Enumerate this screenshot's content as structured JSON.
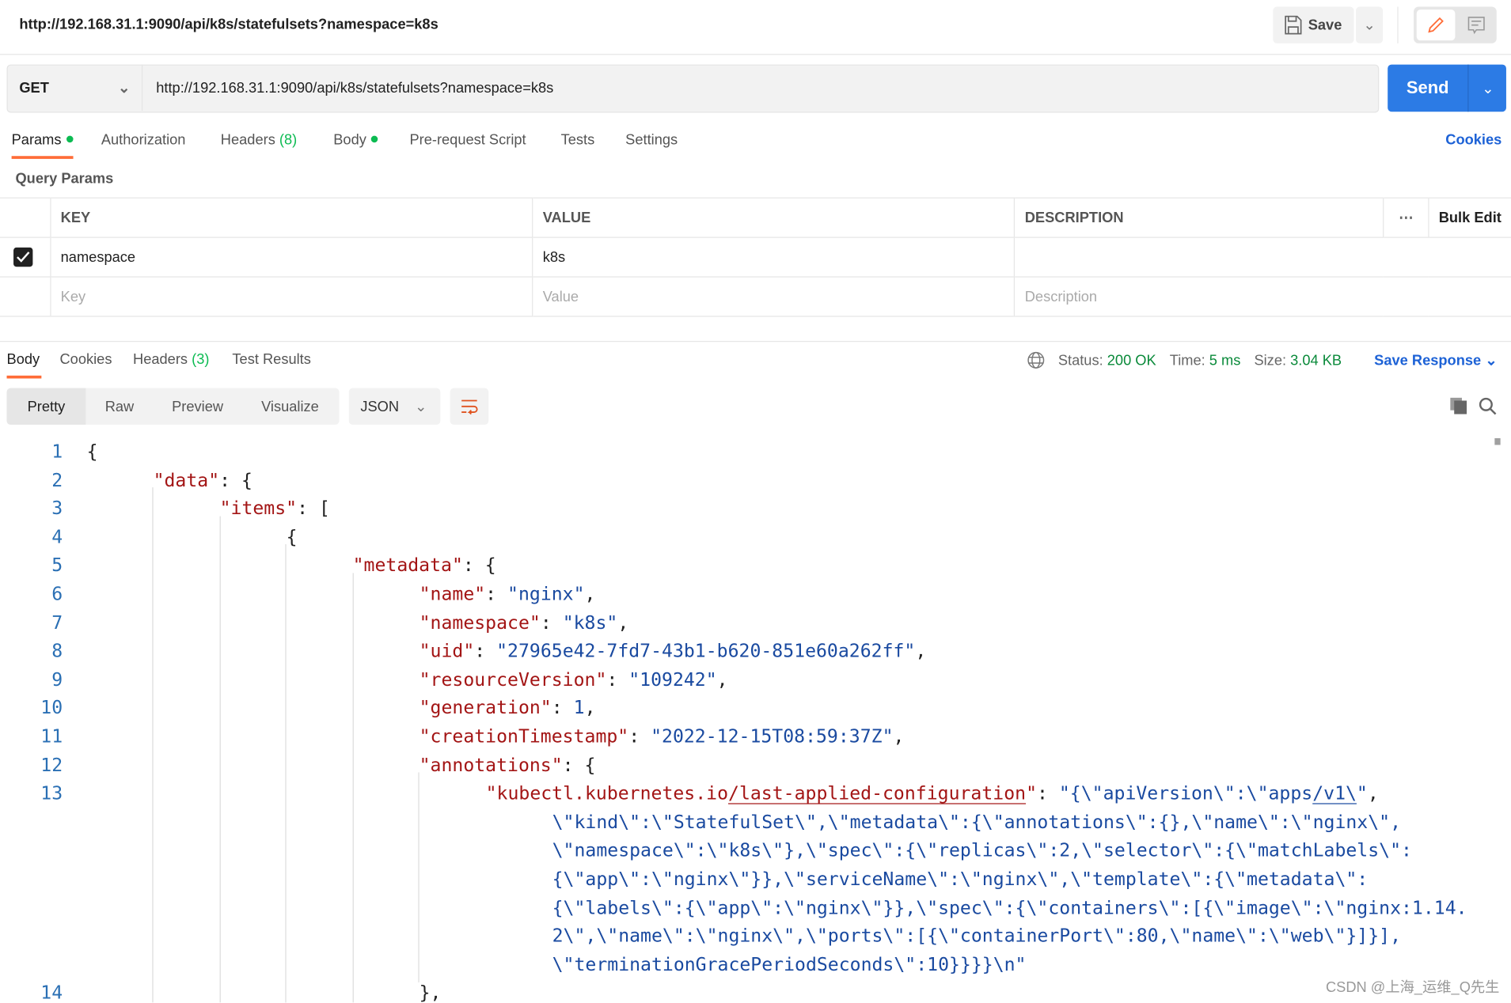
{
  "header": {
    "title": "http://192.168.31.1:9090/api/k8s/statefulsets?namespace=k8s",
    "save_label": "Save"
  },
  "request": {
    "method": "GET",
    "url": "http://192.168.31.1:9090/api/k8s/statefulsets?namespace=k8s",
    "send_label": "Send"
  },
  "tabs": {
    "params": "Params",
    "authorization": "Authorization",
    "headers": "Headers",
    "headers_count": "(8)",
    "body": "Body",
    "prerequest": "Pre-request Script",
    "tests": "Tests",
    "settings": "Settings",
    "cookies": "Cookies"
  },
  "query_params": {
    "title": "Query Params",
    "columns": [
      "KEY",
      "VALUE",
      "DESCRIPTION"
    ],
    "bulk_edit": "Bulk Edit",
    "rows": [
      {
        "checked": true,
        "key": "namespace",
        "value": "k8s",
        "description": ""
      }
    ],
    "placeholders": {
      "key": "Key",
      "value": "Value",
      "description": "Description"
    }
  },
  "response": {
    "tabs": {
      "body": "Body",
      "cookies": "Cookies",
      "headers": "Headers",
      "headers_count": "(3)",
      "test_results": "Test Results"
    },
    "status_label": "Status:",
    "status": "200 OK",
    "time_label": "Time:",
    "time": "5 ms",
    "size_label": "Size:",
    "size": "3.04 KB",
    "save_response": "Save Response",
    "views": [
      "Pretty",
      "Raw",
      "Preview",
      "Visualize"
    ],
    "format": "JSON"
  },
  "colors": {
    "accent": "#ff6c37",
    "send": "#2c7be5",
    "link": "#1d62d6",
    "ok": "#0a8a3a",
    "json_key": "#a31515",
    "json_string": "#1a4aa0"
  },
  "code_lines": [
    {
      "n": "1",
      "indent": 0,
      "t": [
        [
          "p",
          "{"
        ]
      ]
    },
    {
      "n": "2",
      "indent": 1,
      "t": [
        [
          "k",
          "\"data\""
        ],
        [
          "p",
          ": {"
        ]
      ]
    },
    {
      "n": "3",
      "indent": 2,
      "t": [
        [
          "k",
          "\"items\""
        ],
        [
          "p",
          ": ["
        ]
      ]
    },
    {
      "n": "4",
      "indent": 3,
      "t": [
        [
          "p",
          "{"
        ]
      ]
    },
    {
      "n": "5",
      "indent": 4,
      "t": [
        [
          "k",
          "\"metadata\""
        ],
        [
          "p",
          ": {"
        ]
      ]
    },
    {
      "n": "6",
      "indent": 5,
      "t": [
        [
          "k",
          "\"name\""
        ],
        [
          "p",
          ": "
        ],
        [
          "s",
          "\"nginx\""
        ],
        [
          "p",
          ","
        ]
      ]
    },
    {
      "n": "7",
      "indent": 5,
      "t": [
        [
          "k",
          "\"namespace\""
        ],
        [
          "p",
          ": "
        ],
        [
          "s",
          "\"k8s\""
        ],
        [
          "p",
          ","
        ]
      ]
    },
    {
      "n": "8",
      "indent": 5,
      "t": [
        [
          "k",
          "\"uid\""
        ],
        [
          "p",
          ": "
        ],
        [
          "s",
          "\"27965e42-7fd7-43b1-b620-851e60a262ff\""
        ],
        [
          "p",
          ","
        ]
      ]
    },
    {
      "n": "9",
      "indent": 5,
      "t": [
        [
          "k",
          "\"resourceVersion\""
        ],
        [
          "p",
          ": "
        ],
        [
          "s",
          "\"109242\""
        ],
        [
          "p",
          ","
        ]
      ]
    },
    {
      "n": "10",
      "indent": 5,
      "t": [
        [
          "k",
          "\"generation\""
        ],
        [
          "p",
          ": "
        ],
        [
          "n",
          "1"
        ],
        [
          "p",
          ","
        ]
      ]
    },
    {
      "n": "11",
      "indent": 5,
      "t": [
        [
          "k",
          "\"creationTimestamp\""
        ],
        [
          "p",
          ": "
        ],
        [
          "s",
          "\"2022-12-15T08:59:37Z\""
        ],
        [
          "p",
          ","
        ]
      ]
    },
    {
      "n": "12",
      "indent": 5,
      "t": [
        [
          "k",
          "\"annotations\""
        ],
        [
          "p",
          ": {"
        ]
      ]
    },
    {
      "n": "13",
      "indent": 6,
      "t": [
        [
          "k",
          "\"kubectl.kubernetes.io"
        ],
        [
          "k u",
          "/last-applied-configuration"
        ],
        [
          "k",
          "\""
        ],
        [
          "p",
          ": "
        ],
        [
          "s",
          "\"{\\\"apiVersion\\\":\\\"apps"
        ],
        [
          "s u",
          "/v1\\"
        ],
        [
          "s",
          "\""
        ],
        [
          "p",
          ","
        ]
      ]
    },
    {
      "n": "",
      "indent": 7,
      "t": [
        [
          "s",
          "\\\"kind\\\":\\\"StatefulSet\\\",\\\"metadata\\\":{\\\"annotations\\\":{},\\\"name\\\":\\\"nginx\\\","
        ]
      ]
    },
    {
      "n": "",
      "indent": 7,
      "t": [
        [
          "s",
          "\\\"namespace\\\":\\\"k8s\\\"},\\\"spec\\\":{\\\"replicas\\\":2,\\\"selector\\\":{\\\"matchLabels\\\":"
        ]
      ]
    },
    {
      "n": "",
      "indent": 7,
      "t": [
        [
          "s",
          "{\\\"app\\\":\\\"nginx\\\"}},\\\"serviceName\\\":\\\"nginx\\\",\\\"template\\\":{\\\"metadata\\\":"
        ]
      ]
    },
    {
      "n": "",
      "indent": 7,
      "t": [
        [
          "s",
          "{\\\"labels\\\":{\\\"app\\\":\\\"nginx\\\"}},\\\"spec\\\":{\\\"containers\\\":[{\\\"image\\\":\\\"nginx:1.14."
        ]
      ]
    },
    {
      "n": "",
      "indent": 7,
      "t": [
        [
          "s",
          "2\\\",\\\"name\\\":\\\"nginx\\\",\\\"ports\\\":[{\\\"containerPort\\\":80,\\\"name\\\":\\\"web\\\"}]}],"
        ]
      ]
    },
    {
      "n": "",
      "indent": 7,
      "t": [
        [
          "s",
          "\\\"terminationGracePeriodSeconds\\\":10}}}}\\n\""
        ]
      ]
    },
    {
      "n": "14",
      "indent": 5,
      "t": [
        [
          "p",
          "},"
        ]
      ]
    }
  ],
  "watermark": "CSDN @上海_运维_Q先生"
}
